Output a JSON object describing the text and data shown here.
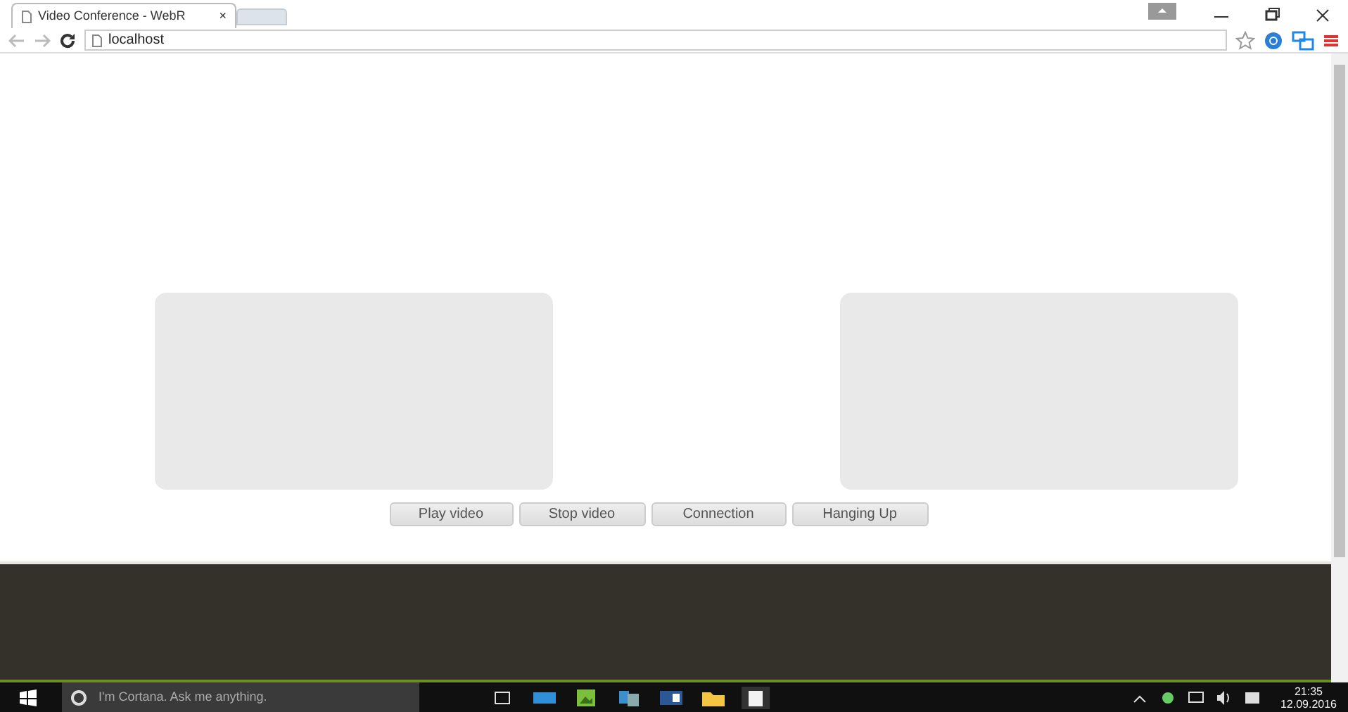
{
  "browser": {
    "tab_title": "Video Conference - WebR",
    "tab_close": "×",
    "address": "localhost"
  },
  "buttons": [
    "Play video",
    "Stop video",
    "Connection",
    "Hanging Up"
  ],
  "taskbar": {
    "search_placeholder": "I'm Cortana. Ask me anything.",
    "time": "21:35",
    "date": "12.09.2016"
  }
}
